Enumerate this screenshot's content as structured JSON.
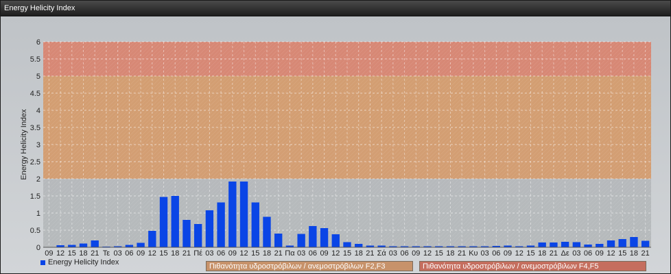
{
  "window": {
    "title": "Energy Helicity Index"
  },
  "colors": {
    "series": "#0a45e6",
    "band_low": "#b4b7ba",
    "band_mid": "#d49a6a",
    "band_high": "#d9826e"
  },
  "legend": {
    "series_label": "Energy Helicity Index",
    "band_f23": "Πιθανότητα υδροστρόβιλων / ανεμοστρόβιλων F2,F3",
    "band_f45": "Πιθανότητα υδροστρόβιλων / ανεμοστρόβιλων F4,F5"
  },
  "chart_data": {
    "type": "bar",
    "title": "",
    "xlabel": "",
    "ylabel": "Energy Helicity Index",
    "ylim": [
      0,
      6
    ],
    "yticks": [
      "0",
      "0.5",
      "1",
      "1.5",
      "2",
      "2.5",
      "3",
      "3.5",
      "4",
      "4.5",
      "5",
      "5.5",
      "6"
    ],
    "grid": true,
    "bands": [
      {
        "from": 0,
        "to": 2,
        "color": "#b4b7ba"
      },
      {
        "from": 2,
        "to": 5,
        "color": "#d49a6a",
        "label": "Πιθανότητα υδροστρόβιλων / ανεμοστρόβιλων F2,F3"
      },
      {
        "from": 5,
        "to": 6,
        "color": "#d9826e",
        "label": "Πιθανότητα υδροστρόβιλων / ανεμοστρόβιλων F4,F5"
      }
    ],
    "categories": [
      "09",
      "12",
      "15",
      "18",
      "21",
      "Τε",
      "03",
      "06",
      "09",
      "12",
      "15",
      "18",
      "21",
      "Πέ",
      "03",
      "06",
      "09",
      "12",
      "15",
      "18",
      "21",
      "Πα",
      "03",
      "06",
      "09",
      "12",
      "15",
      "18",
      "21",
      "Σά",
      "03",
      "06",
      "09",
      "12",
      "15",
      "18",
      "21",
      "Κυ",
      "03",
      "06",
      "09",
      "12",
      "15",
      "18",
      "21",
      "Δε",
      "03",
      "06",
      "09",
      "12",
      "15",
      "18",
      "21"
    ],
    "series": [
      {
        "name": "Energy Helicity Index",
        "values": [
          0.01,
          0.06,
          0.07,
          0.11,
          0.2,
          0.02,
          0.03,
          0.07,
          0.13,
          0.48,
          1.47,
          1.5,
          0.8,
          0.68,
          1.08,
          1.31,
          1.92,
          1.92,
          1.31,
          0.89,
          0.4,
          0.05,
          0.39,
          0.62,
          0.56,
          0.38,
          0.15,
          0.1,
          0.05,
          0.05,
          0.03,
          0.03,
          0.03,
          0.03,
          0.03,
          0.03,
          0.03,
          0.03,
          0.03,
          0.04,
          0.05,
          0.03,
          0.05,
          0.14,
          0.14,
          0.16,
          0.15,
          0.08,
          0.1,
          0.2,
          0.24,
          0.3,
          0.19
        ]
      }
    ]
  }
}
